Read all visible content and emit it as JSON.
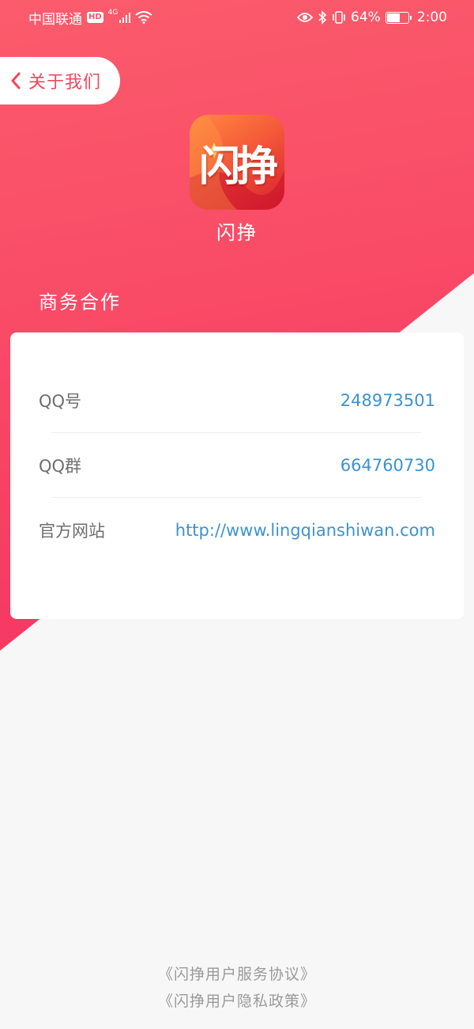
{
  "status_bar": {
    "carrier": "中国联通",
    "hd": "HD",
    "network": "4G",
    "battery_percent": "64%",
    "battery_level": 0.64,
    "time": "2:00"
  },
  "nav": {
    "back_label": "关于我们"
  },
  "app": {
    "logo_text": "闪挣",
    "name": "闪挣"
  },
  "section": {
    "title": "商务合作"
  },
  "contact_rows": [
    {
      "label": "QQ号",
      "value": "248973501"
    },
    {
      "label": "QQ群",
      "value": "664760730"
    },
    {
      "label": "官方网站",
      "value": "http://www.lingqianshiwan.com"
    }
  ],
  "footer": {
    "service_agreement": "《闪挣用户服务协议》",
    "privacy_policy": "《闪挣用户隐私政策》"
  },
  "colors": {
    "accent": "#f2475e",
    "link": "#3c93cf",
    "hero_top": "#fb5c6c",
    "hero_bottom": "#f43462"
  }
}
